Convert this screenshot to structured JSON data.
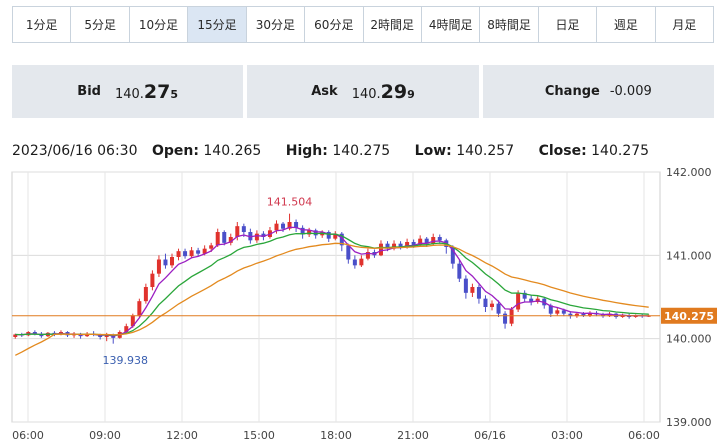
{
  "timeframe_tabs": [
    "1分足",
    "5分足",
    "10分足",
    "15分足",
    "30分足",
    "60分足",
    "2時間足",
    "4時間足",
    "8時間足",
    "日足",
    "週足",
    "月足"
  ],
  "active_tab": "15分足",
  "quote": {
    "bid_label": "Bid",
    "bid_main": "140.",
    "bid_big": "27",
    "bid_small": "5",
    "ask_label": "Ask",
    "ask_main": "140.",
    "ask_big": "29",
    "ask_small": "9",
    "change_label": "Change",
    "change_value": "-0.009"
  },
  "ohlc": {
    "datetime": "2023/06/16 06:30",
    "open_label": "Open:",
    "open": "140.265",
    "high_label": "High:",
    "high": "140.275",
    "low_label": "Low:",
    "low": "140.257",
    "close_label": "Close:",
    "close": "140.275"
  },
  "colors": {
    "up": "#e0322d",
    "down": "#4a4fc9",
    "ma_short": "#9b1fc2",
    "ma_mid": "#2aa63a",
    "ma_long": "#e38a1f",
    "price_line": "#e07a1f",
    "price_label_bg": "#e07a1f"
  },
  "chart_data": {
    "type": "candlestick",
    "y_ticks": [
      "142.000",
      "141.000",
      "140.000",
      "139.000"
    ],
    "ylim": [
      139.0,
      142.0
    ],
    "x_ticks": [
      "06:00",
      "09:00",
      "12:00",
      "15:00",
      "18:00",
      "21:00",
      "06/16",
      "03:00",
      "06:00"
    ],
    "current_price": "140.275",
    "annotations": {
      "high": "141.504",
      "low": "139.938"
    },
    "candles": [
      [
        140.02,
        140.05,
        140.06,
        140.0
      ],
      [
        140.05,
        140.04,
        140.07,
        140.02
      ],
      [
        140.04,
        140.08,
        140.09,
        140.03
      ],
      [
        140.08,
        140.06,
        140.1,
        140.04
      ],
      [
        140.06,
        140.03,
        140.08,
        140.01
      ],
      [
        140.03,
        140.07,
        140.08,
        140.02
      ],
      [
        140.07,
        140.05,
        140.09,
        140.03
      ],
      [
        140.05,
        140.08,
        140.1,
        140.04
      ],
      [
        140.08,
        140.04,
        140.09,
        140.02
      ],
      [
        140.04,
        140.06,
        140.08,
        140.01
      ],
      [
        140.06,
        140.03,
        140.07,
        140.0
      ],
      [
        140.03,
        140.06,
        140.08,
        140.02
      ],
      [
        140.06,
        140.05,
        140.09,
        140.03
      ],
      [
        140.05,
        140.02,
        140.06,
        139.99
      ],
      [
        140.02,
        140.05,
        140.07,
        139.97
      ],
      [
        140.05,
        140.01,
        140.06,
        139.94
      ],
      [
        140.01,
        140.08,
        140.1,
        140.0
      ],
      [
        140.08,
        140.15,
        140.18,
        140.06
      ],
      [
        140.15,
        140.28,
        140.3,
        140.13
      ],
      [
        140.28,
        140.45,
        140.48,
        140.26
      ],
      [
        140.45,
        140.62,
        140.66,
        140.42
      ],
      [
        140.62,
        140.78,
        140.82,
        140.58
      ],
      [
        140.78,
        140.95,
        141.0,
        140.74
      ],
      [
        140.95,
        140.88,
        141.02,
        140.84
      ],
      [
        140.88,
        140.98,
        141.02,
        140.85
      ],
      [
        140.98,
        141.05,
        141.08,
        140.94
      ],
      [
        141.05,
        140.99,
        141.08,
        140.96
      ],
      [
        140.99,
        141.06,
        141.1,
        140.97
      ],
      [
        141.06,
        141.02,
        141.09,
        140.99
      ],
      [
        141.02,
        141.08,
        141.12,
        141.0
      ],
      [
        141.08,
        141.12,
        141.15,
        141.04
      ],
      [
        141.12,
        141.28,
        141.32,
        141.1
      ],
      [
        141.28,
        141.15,
        141.3,
        141.12
      ],
      [
        141.15,
        141.22,
        141.26,
        141.12
      ],
      [
        141.22,
        141.35,
        141.4,
        141.18
      ],
      [
        141.35,
        141.28,
        141.38,
        141.22
      ],
      [
        141.28,
        141.18,
        141.32,
        141.14
      ],
      [
        141.18,
        141.26,
        141.3,
        141.15
      ],
      [
        141.26,
        141.22,
        141.29,
        141.18
      ],
      [
        141.22,
        141.3,
        141.34,
        141.2
      ],
      [
        141.3,
        141.38,
        141.42,
        141.26
      ],
      [
        141.38,
        141.32,
        141.4,
        141.28
      ],
      [
        141.32,
        141.4,
        141.5,
        141.3
      ],
      [
        141.4,
        141.33,
        141.43,
        141.28
      ],
      [
        141.33,
        141.25,
        141.36,
        141.2
      ],
      [
        141.25,
        141.3,
        141.33,
        141.22
      ],
      [
        141.3,
        141.24,
        141.32,
        141.2
      ],
      [
        141.24,
        141.28,
        141.3,
        141.21
      ],
      [
        141.28,
        141.2,
        141.3,
        141.16
      ],
      [
        141.2,
        141.26,
        141.29,
        141.18
      ],
      [
        141.26,
        141.12,
        141.28,
        141.05
      ],
      [
        141.12,
        140.95,
        141.14,
        140.9
      ],
      [
        140.95,
        140.88,
        141.0,
        140.84
      ],
      [
        140.88,
        140.96,
        141.0,
        140.86
      ],
      [
        140.96,
        141.04,
        141.08,
        140.94
      ],
      [
        141.04,
        141.0,
        141.07,
        140.97
      ],
      [
        141.0,
        141.14,
        141.18,
        140.99
      ],
      [
        141.14,
        141.08,
        141.17,
        141.05
      ],
      [
        141.08,
        141.14,
        141.18,
        141.06
      ],
      [
        141.14,
        141.1,
        141.17,
        141.07
      ],
      [
        141.1,
        141.16,
        141.2,
        141.08
      ],
      [
        141.16,
        141.12,
        141.19,
        141.09
      ],
      [
        141.12,
        141.2,
        141.24,
        141.1
      ],
      [
        141.2,
        141.14,
        141.22,
        141.1
      ],
      [
        141.14,
        141.22,
        141.26,
        141.12
      ],
      [
        141.22,
        141.18,
        141.25,
        141.14
      ],
      [
        141.18,
        141.1,
        141.2,
        141.02
      ],
      [
        141.1,
        140.9,
        141.12,
        140.84
      ],
      [
        140.9,
        140.72,
        140.94,
        140.68
      ],
      [
        140.72,
        140.55,
        140.76,
        140.48
      ],
      [
        140.55,
        140.62,
        140.66,
        140.5
      ],
      [
        140.62,
        140.48,
        140.65,
        140.42
      ],
      [
        140.48,
        140.38,
        140.52,
        140.32
      ],
      [
        140.38,
        140.42,
        140.46,
        140.34
      ],
      [
        140.42,
        140.3,
        140.46,
        140.26
      ],
      [
        140.3,
        140.18,
        140.33,
        140.12
      ],
      [
        140.18,
        140.35,
        140.38,
        140.15
      ],
      [
        140.35,
        140.55,
        140.58,
        140.32
      ],
      [
        140.55,
        140.48,
        140.58,
        140.44
      ],
      [
        140.48,
        140.44,
        140.52,
        140.4
      ],
      [
        140.44,
        140.48,
        140.51,
        140.42
      ],
      [
        140.48,
        140.4,
        140.5,
        140.36
      ],
      [
        140.4,
        140.3,
        140.42,
        140.26
      ],
      [
        140.3,
        140.34,
        140.37,
        140.28
      ],
      [
        140.34,
        140.3,
        140.36,
        140.27
      ],
      [
        140.3,
        140.27,
        140.33,
        140.24
      ],
      [
        140.27,
        140.3,
        140.32,
        140.25
      ],
      [
        140.3,
        140.28,
        140.32,
        140.26
      ],
      [
        140.28,
        140.31,
        140.33,
        140.26
      ],
      [
        140.31,
        140.29,
        140.33,
        140.27
      ],
      [
        140.29,
        140.27,
        140.31,
        140.25
      ],
      [
        140.27,
        140.3,
        140.32,
        140.26
      ],
      [
        140.3,
        140.26,
        140.31,
        140.24
      ],
      [
        140.26,
        140.28,
        140.3,
        140.25
      ],
      [
        140.28,
        140.26,
        140.3,
        140.24
      ],
      [
        140.26,
        140.28,
        140.29,
        140.25
      ],
      [
        140.28,
        140.27,
        140.29,
        140.25
      ],
      [
        140.27,
        140.275,
        140.29,
        140.26
      ]
    ]
  }
}
